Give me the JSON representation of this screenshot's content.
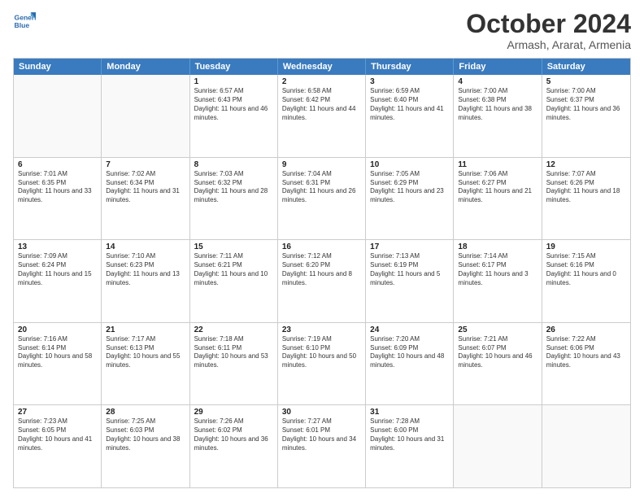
{
  "header": {
    "logo_line1": "General",
    "logo_line2": "Blue",
    "month_title": "October 2024",
    "subtitle": "Armash, Ararat, Armenia"
  },
  "days_of_week": [
    "Sunday",
    "Monday",
    "Tuesday",
    "Wednesday",
    "Thursday",
    "Friday",
    "Saturday"
  ],
  "weeks": [
    [
      {
        "day": "",
        "text": ""
      },
      {
        "day": "",
        "text": ""
      },
      {
        "day": "1",
        "text": "Sunrise: 6:57 AM\nSunset: 6:43 PM\nDaylight: 11 hours and 46 minutes."
      },
      {
        "day": "2",
        "text": "Sunrise: 6:58 AM\nSunset: 6:42 PM\nDaylight: 11 hours and 44 minutes."
      },
      {
        "day": "3",
        "text": "Sunrise: 6:59 AM\nSunset: 6:40 PM\nDaylight: 11 hours and 41 minutes."
      },
      {
        "day": "4",
        "text": "Sunrise: 7:00 AM\nSunset: 6:38 PM\nDaylight: 11 hours and 38 minutes."
      },
      {
        "day": "5",
        "text": "Sunrise: 7:00 AM\nSunset: 6:37 PM\nDaylight: 11 hours and 36 minutes."
      }
    ],
    [
      {
        "day": "6",
        "text": "Sunrise: 7:01 AM\nSunset: 6:35 PM\nDaylight: 11 hours and 33 minutes."
      },
      {
        "day": "7",
        "text": "Sunrise: 7:02 AM\nSunset: 6:34 PM\nDaylight: 11 hours and 31 minutes."
      },
      {
        "day": "8",
        "text": "Sunrise: 7:03 AM\nSunset: 6:32 PM\nDaylight: 11 hours and 28 minutes."
      },
      {
        "day": "9",
        "text": "Sunrise: 7:04 AM\nSunset: 6:31 PM\nDaylight: 11 hours and 26 minutes."
      },
      {
        "day": "10",
        "text": "Sunrise: 7:05 AM\nSunset: 6:29 PM\nDaylight: 11 hours and 23 minutes."
      },
      {
        "day": "11",
        "text": "Sunrise: 7:06 AM\nSunset: 6:27 PM\nDaylight: 11 hours and 21 minutes."
      },
      {
        "day": "12",
        "text": "Sunrise: 7:07 AM\nSunset: 6:26 PM\nDaylight: 11 hours and 18 minutes."
      }
    ],
    [
      {
        "day": "13",
        "text": "Sunrise: 7:09 AM\nSunset: 6:24 PM\nDaylight: 11 hours and 15 minutes."
      },
      {
        "day": "14",
        "text": "Sunrise: 7:10 AM\nSunset: 6:23 PM\nDaylight: 11 hours and 13 minutes."
      },
      {
        "day": "15",
        "text": "Sunrise: 7:11 AM\nSunset: 6:21 PM\nDaylight: 11 hours and 10 minutes."
      },
      {
        "day": "16",
        "text": "Sunrise: 7:12 AM\nSunset: 6:20 PM\nDaylight: 11 hours and 8 minutes."
      },
      {
        "day": "17",
        "text": "Sunrise: 7:13 AM\nSunset: 6:19 PM\nDaylight: 11 hours and 5 minutes."
      },
      {
        "day": "18",
        "text": "Sunrise: 7:14 AM\nSunset: 6:17 PM\nDaylight: 11 hours and 3 minutes."
      },
      {
        "day": "19",
        "text": "Sunrise: 7:15 AM\nSunset: 6:16 PM\nDaylight: 11 hours and 0 minutes."
      }
    ],
    [
      {
        "day": "20",
        "text": "Sunrise: 7:16 AM\nSunset: 6:14 PM\nDaylight: 10 hours and 58 minutes."
      },
      {
        "day": "21",
        "text": "Sunrise: 7:17 AM\nSunset: 6:13 PM\nDaylight: 10 hours and 55 minutes."
      },
      {
        "day": "22",
        "text": "Sunrise: 7:18 AM\nSunset: 6:11 PM\nDaylight: 10 hours and 53 minutes."
      },
      {
        "day": "23",
        "text": "Sunrise: 7:19 AM\nSunset: 6:10 PM\nDaylight: 10 hours and 50 minutes."
      },
      {
        "day": "24",
        "text": "Sunrise: 7:20 AM\nSunset: 6:09 PM\nDaylight: 10 hours and 48 minutes."
      },
      {
        "day": "25",
        "text": "Sunrise: 7:21 AM\nSunset: 6:07 PM\nDaylight: 10 hours and 46 minutes."
      },
      {
        "day": "26",
        "text": "Sunrise: 7:22 AM\nSunset: 6:06 PM\nDaylight: 10 hours and 43 minutes."
      }
    ],
    [
      {
        "day": "27",
        "text": "Sunrise: 7:23 AM\nSunset: 6:05 PM\nDaylight: 10 hours and 41 minutes."
      },
      {
        "day": "28",
        "text": "Sunrise: 7:25 AM\nSunset: 6:03 PM\nDaylight: 10 hours and 38 minutes."
      },
      {
        "day": "29",
        "text": "Sunrise: 7:26 AM\nSunset: 6:02 PM\nDaylight: 10 hours and 36 minutes."
      },
      {
        "day": "30",
        "text": "Sunrise: 7:27 AM\nSunset: 6:01 PM\nDaylight: 10 hours and 34 minutes."
      },
      {
        "day": "31",
        "text": "Sunrise: 7:28 AM\nSunset: 6:00 PM\nDaylight: 10 hours and 31 minutes."
      },
      {
        "day": "",
        "text": ""
      },
      {
        "day": "",
        "text": ""
      }
    ]
  ]
}
